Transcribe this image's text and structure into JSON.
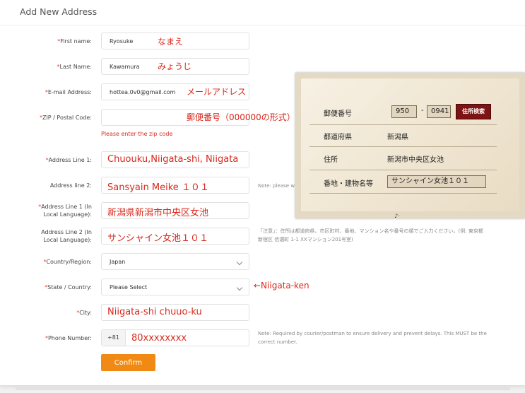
{
  "page": {
    "title": "Add New Address"
  },
  "form": {
    "first_name": {
      "label": "First name:",
      "value": "Ryosuke",
      "note": "なまえ"
    },
    "last_name": {
      "label": "Last Name:",
      "value": "Kawamura",
      "note": "みょうじ"
    },
    "email": {
      "label": "E-mail Address:",
      "value": "hottea.0v0@gmail.com",
      "note": "メールアドレス"
    },
    "zip": {
      "label": "ZIP / Postal Code:",
      "value": "",
      "note": "郵便番号（000000の形式）",
      "error": "Please enter the zip code"
    },
    "address1": {
      "label": "Address Line 1:",
      "value": "Chuouku,Niigata-shi,  Niigata"
    },
    "address2": {
      "label": "Address line 2:",
      "value": "Sansyain   Meike   １０１",
      "hint": "Note: please w"
    },
    "address1_local": {
      "label_line1": "Address Line 1 (In",
      "label_line2": "Local Language):",
      "value": "新潟県新潟市中央区女池"
    },
    "address2_local": {
      "label_line1": "Address Line 2 (In",
      "label_line2": "Local Language):",
      "value": "サンシャイン女池１０１",
      "hint_line1": "「注意」：住所は都道府県、市区町村、番地、マンション名や番号の順でご入力ください。(例: 東京都",
      "hint_line2": "新宿区 信濃町 1-1 XXマンション201号室)"
    },
    "country": {
      "label": "Country/Region:",
      "value": "Japan"
    },
    "state": {
      "label": "State / Country:",
      "value": "Please Select",
      "note": "←Niigata-ken"
    },
    "city": {
      "label": "City:",
      "value": "Niigata-shi  chuuo-ku"
    },
    "phone": {
      "label": "Phone Number:",
      "prefix": "+81",
      "value": "80xxxxxxxx",
      "hint_line1": "Note: Required by courier/postman to ensure delivery and prevent delays. This MUST be the",
      "hint_line2": "correct number."
    },
    "confirm_label": "Confirm"
  },
  "overlay": {
    "postal_label": "郵便番号",
    "postal_part1": "950",
    "postal_dash": "-",
    "postal_part2": "0941",
    "search_button": "住所検索",
    "prefecture_label": "都道府県",
    "prefecture_value": "新潟県",
    "address_label": "住所",
    "address_value": "新潟市中央区女池",
    "building_label": "番地・建物名等",
    "building_value": "サンシャイン女池１０１",
    "cut_text": "♪·"
  },
  "colors": {
    "accent": "#f08a14",
    "required": "#e0403b",
    "annotation": "#d8281c",
    "overlay_button": "#7d1313"
  }
}
